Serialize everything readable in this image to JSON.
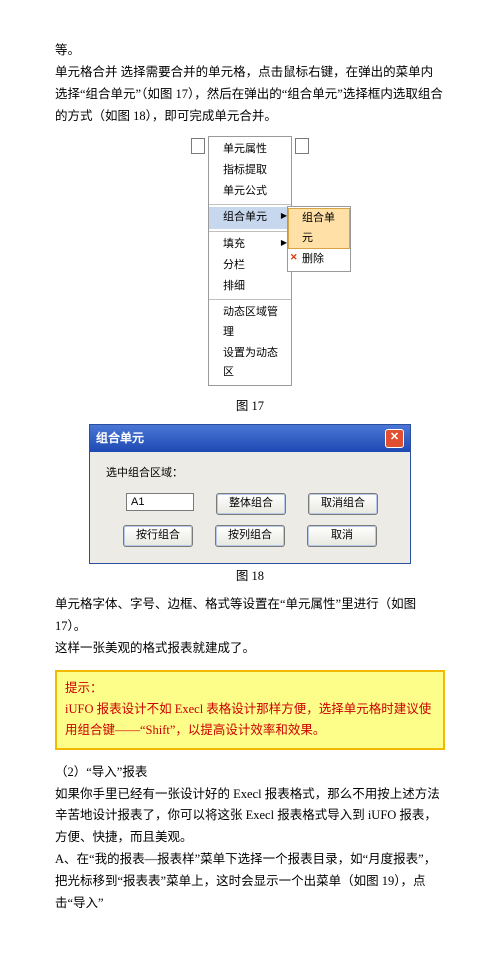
{
  "para1_l1": "等。",
  "para1_l2": "单元格合并 选择需要合并的单元格，点击鼠标右键，在弹出的菜单内选择“组合单元”（如图 17），然后在弹出的“组合单元”选择框内选取组合的方式（如图 18），即可完成单元合并。",
  "menu": {
    "i1": "单元属性",
    "i2": "指标提取",
    "i3": "单元公式",
    "i4": "组合单元",
    "i5": "填充",
    "i6": "分栏",
    "i7": "排细",
    "i8": "动态区域管理",
    "i9": "设置为动态区"
  },
  "submenu": {
    "s1": "组合单元",
    "s2": "删除"
  },
  "fig17": "图 17",
  "dialog": {
    "title": "组合单元",
    "label": "选中组合区域：",
    "cell": "A1",
    "b1": "整体组合",
    "b2": "取消组合",
    "b3": "按行组合",
    "b4": "按列组合",
    "b5": "取消"
  },
  "fig18": "图 18",
  "para2_l1": "单元格字体、字号、边框、格式等设置在“单元属性”里进行（如图 17）。",
  "para2_l2": "这样一张美观的格式报表就建成了。",
  "tip_head": "提示：",
  "tip_body": "iUFO 报表设计不如 Execl 表格设计那样方便，选择单元格时建议使用组合键——“Shift”，以提高设计效率和效果。",
  "sec_title": "（2）“导入”报表",
  "para3": "如果你手里已经有一张设计好的 Execl 报表格式，那么不用按上述方法辛苦地设计报表了，你可以将这张 Execl 报表格式导入到 iUFO 报表，方便、快捷，而且美观。",
  "para4": "A、在“我的报表—报表样”菜单下选择一个报表目录，如“月度报表”，把光标移到“报表表”菜单上，这时会显示一个出菜单（如图 19），点击“导入”"
}
